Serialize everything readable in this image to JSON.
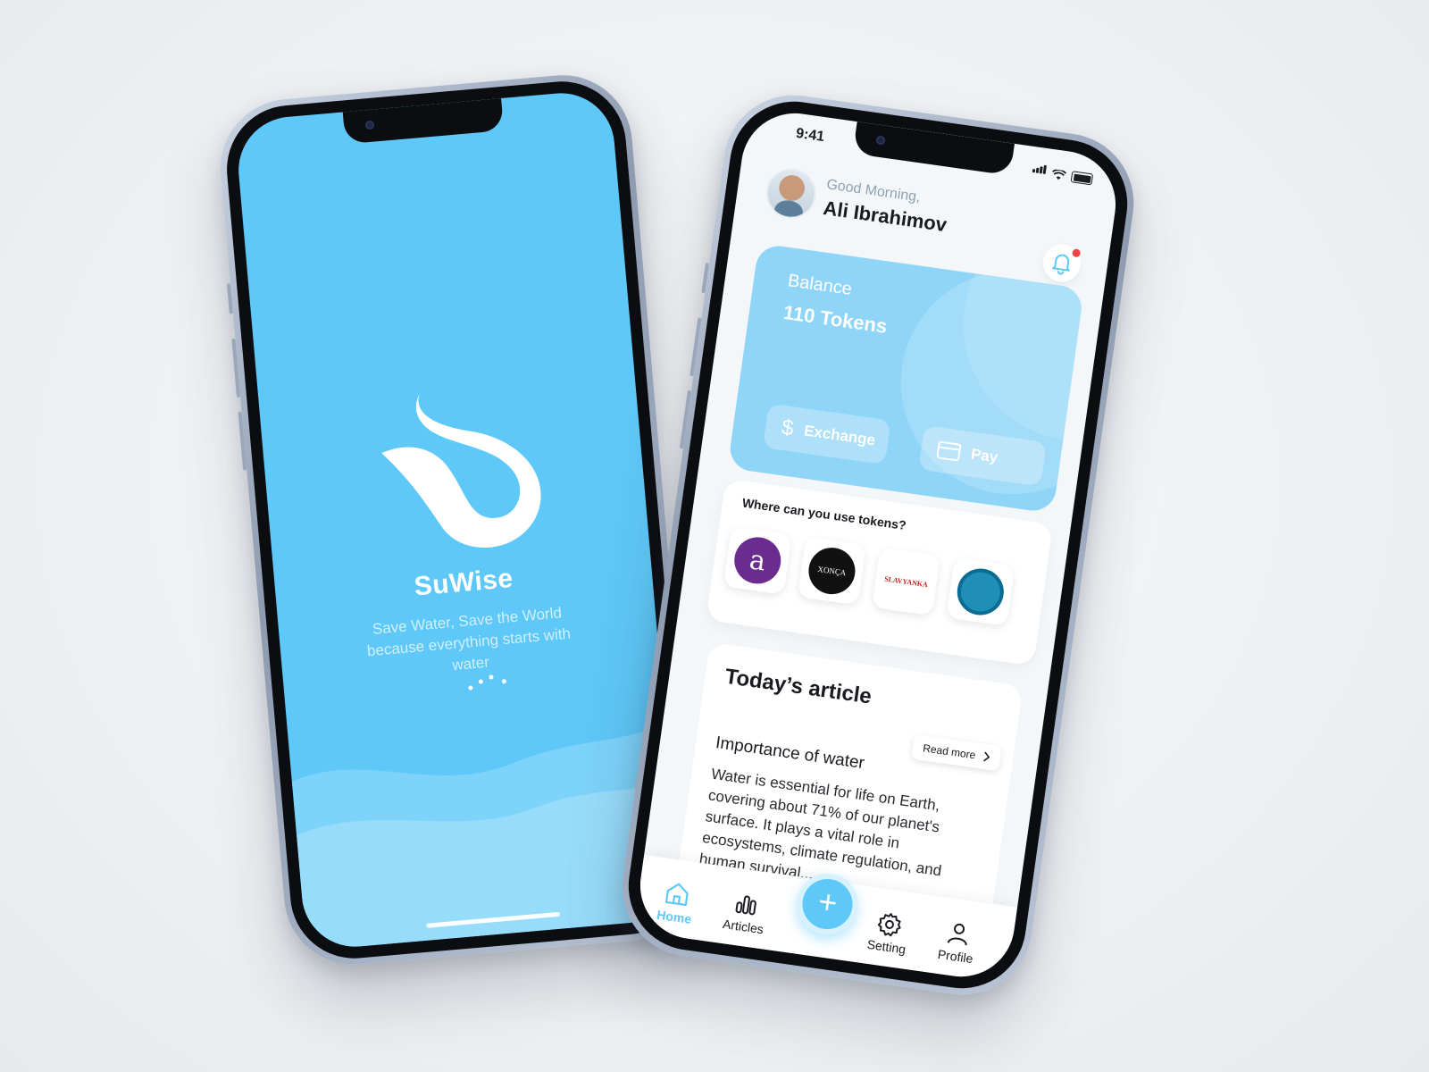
{
  "splash": {
    "app_name": "SuWise",
    "tagline": "Save Water, Save the World because everything starts with water"
  },
  "home": {
    "status_time": "9:41",
    "greeting": "Good Morning,",
    "user_name": "Ali Ibrahimov",
    "balance": {
      "label": "Balance",
      "value": "110 Tokens",
      "exchange_label": "Exchange",
      "pay_label": "Pay"
    },
    "merchants": {
      "title": "Where can you use tokens?",
      "items": [
        {
          "logo_text": "a"
        },
        {
          "logo_text": "XONÇA"
        },
        {
          "logo_text": "SLAVYANKA"
        },
        {
          "logo_text": ""
        }
      ]
    },
    "article": {
      "section_title": "Today’s article",
      "read_more": "Read more",
      "heading": "Importance of water",
      "body": "Water is essential for life on Earth, covering about 71% of our planet's surface. It plays a vital role in ecosystems, climate regulation, and human survival..."
    },
    "tabs": [
      {
        "label": "Home"
      },
      {
        "label": "Articles"
      },
      {
        "label": "Setting"
      },
      {
        "label": "Profile"
      }
    ],
    "fab_label": "+"
  },
  "colors": {
    "brand": "#5ec8f8",
    "card": "#8fd5f8",
    "notification_dot": "#ef4444"
  }
}
